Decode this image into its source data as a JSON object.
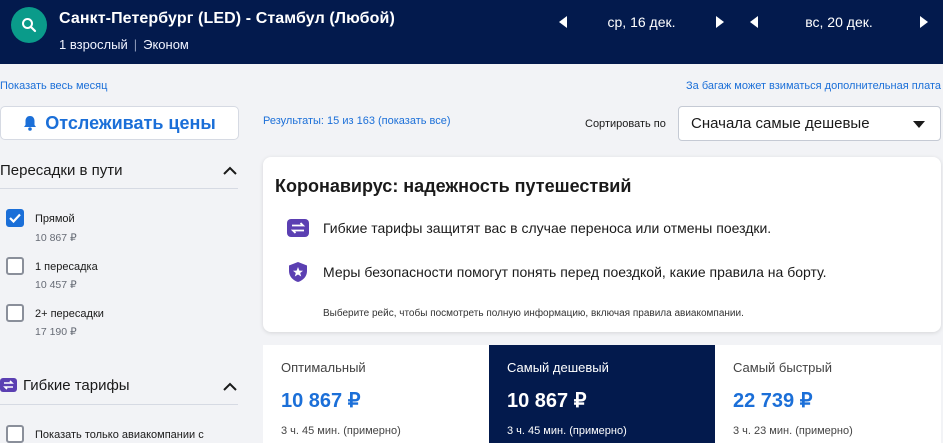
{
  "header": {
    "route": "Санкт-Петербург (LED) - Стамбул (Любой)",
    "passengers": "1 взрослый",
    "cabin": "Эконом",
    "depart_date": "ср, 16 дек.",
    "return_date": "вс, 20 дек."
  },
  "links": {
    "show_month": "Показать весь месяц",
    "baggage_note": "За багаж может взиматься дополнительная плата"
  },
  "track": {
    "label": "Отслеживать цены"
  },
  "filters": {
    "stops": {
      "title": "Пересадки в пути",
      "options": [
        {
          "label": "Прямой",
          "price": "10 867 ₽",
          "checked": true
        },
        {
          "label": "1 пересадка",
          "price": "10 457 ₽",
          "checked": false
        },
        {
          "label": "2+ пересадки",
          "price": "17 190 ₽",
          "checked": false
        }
      ]
    },
    "flex": {
      "title": "Гибкие тарифы",
      "option_label": "Показать только авиакомпании с"
    }
  },
  "results": {
    "text": "Результаты: 15 из 163 (показать все)"
  },
  "sort": {
    "label": "Сортировать по",
    "value": "Сначала самые дешевые"
  },
  "covid": {
    "title": "Коронавирус: надежность путешествий",
    "line1": "Гибкие тарифы защитят вас в случае переноса или отмены поездки.",
    "line2": "Меры безопасности помогут понять перед поездкой, какие правила на борту.",
    "note": "Выберите рейс, чтобы посмотреть полную информацию, включая правила авиакомпании."
  },
  "tabs": [
    {
      "name": "Оптимальный",
      "price": "10 867 ₽",
      "duration": "3 ч. 45 мин. (примерно)",
      "active": false
    },
    {
      "name": "Самый дешевый",
      "price": "10 867 ₽",
      "duration": "3 ч. 45 мин. (примерно)",
      "active": true
    },
    {
      "name": "Самый быстрый",
      "price": "22 739 ₽",
      "duration": "3 ч. 23 мин. (примерно)",
      "active": false
    }
  ],
  "colors": {
    "navy": "#031a4d",
    "accent": "#1b6fd8",
    "teal": "#0a9b8a",
    "purple": "#5b3fb2"
  }
}
